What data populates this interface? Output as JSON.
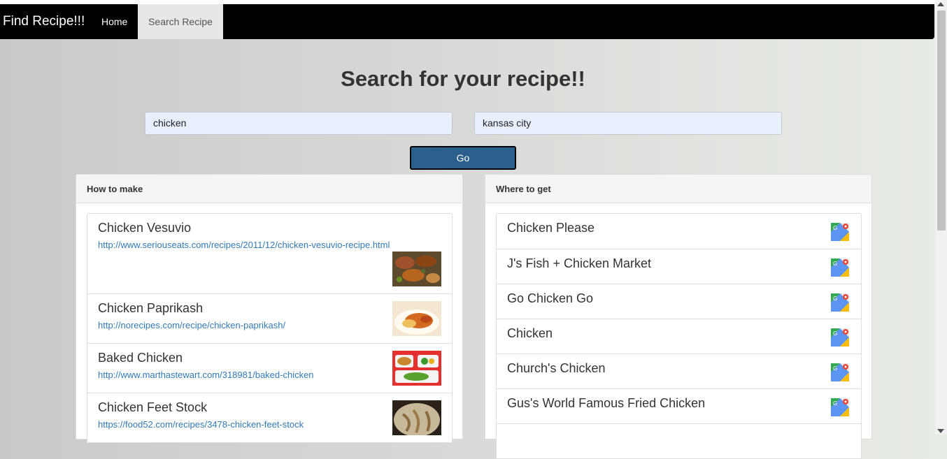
{
  "nav": {
    "brand": "Find Recipe!!!",
    "home_label": "Home",
    "search_label": "Search Recipe"
  },
  "main": {
    "title": "Search for your recipe!!",
    "recipe_input_value": "chicken",
    "city_input_value": "kansas city",
    "go_label": "Go"
  },
  "how_to_make": {
    "header": "How to make",
    "recipes": [
      {
        "name": "Chicken Vesuvio",
        "link": "http://www.seriouseats.com/recipes/2011/12/chicken-vesuvio-recipe.html"
      },
      {
        "name": "Chicken Paprikash",
        "link": "http://norecipes.com/recipe/chicken-paprikash/"
      },
      {
        "name": "Baked Chicken",
        "link": "http://www.marthastewart.com/318981/baked-chicken"
      },
      {
        "name": "Chicken Feet Stock",
        "link": "https://food52.com/recipes/3478-chicken-feet-stock"
      }
    ]
  },
  "where_to_get": {
    "header": "Where to get",
    "places": [
      {
        "name": "Chicken Please",
        "icon": "google-maps-icon"
      },
      {
        "name": "J's Fish + Chicken Market",
        "icon": "google-maps-icon"
      },
      {
        "name": "Go Chicken Go",
        "icon": "google-maps-icon"
      },
      {
        "name": "Chicken",
        "icon": "google-maps-icon"
      },
      {
        "name": "Church's Chicken",
        "icon": "google-maps-icon"
      },
      {
        "name": "Gus's World Famous Fried Chicken",
        "icon": "google-maps-icon"
      }
    ]
  },
  "colors": {
    "navbar": "#000000",
    "active_tab": "#e7e7e7",
    "go_button": "#2b5f8c",
    "link": "#337ab7",
    "input_bg": "#e8f0fe"
  }
}
